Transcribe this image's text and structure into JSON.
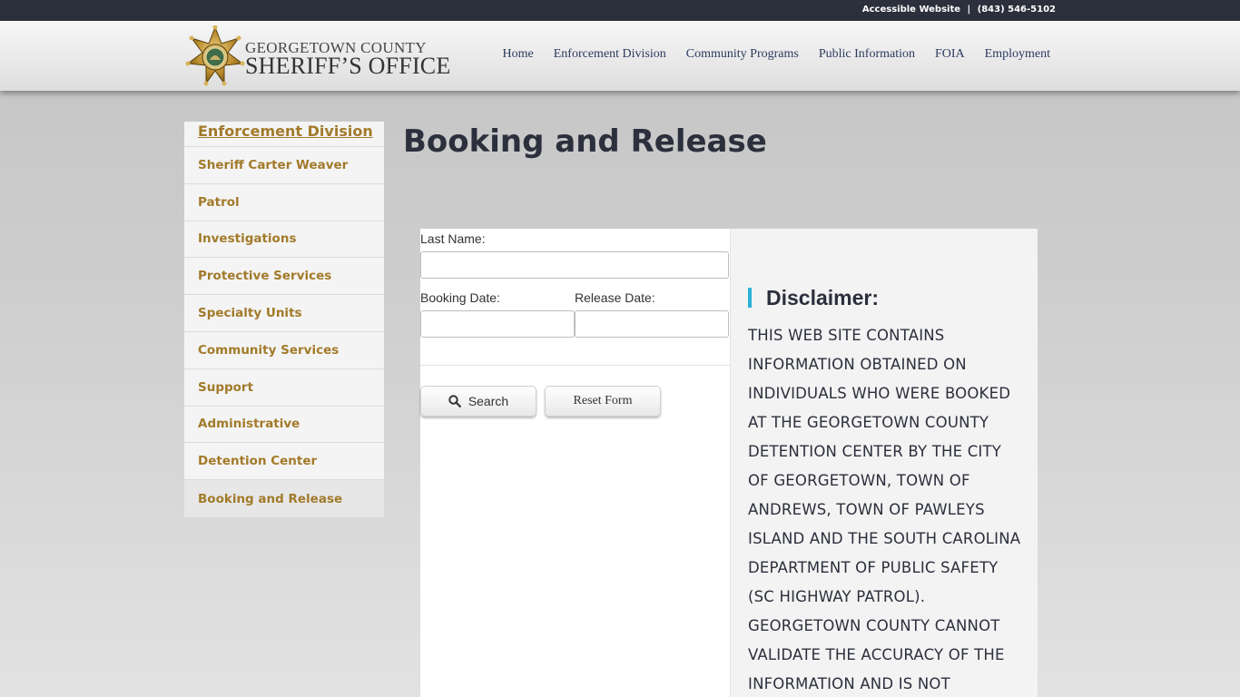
{
  "topbar": {
    "accessible_link": "Accessible Website",
    "separator": "|",
    "phone": "(843) 546-5102"
  },
  "logo": {
    "line1": "GEORGETOWN COUNTY",
    "line2": "SHERIFF’S OFFICE"
  },
  "nav": {
    "items": [
      "Home",
      "Enforcement Division",
      "Community Programs",
      "Public Information",
      "FOIA",
      "Employment"
    ]
  },
  "sidebar": {
    "heading": "Enforcement Division",
    "items": [
      {
        "label": "Sheriff Carter Weaver"
      },
      {
        "label": "Patrol"
      },
      {
        "label": "Investigations"
      },
      {
        "label": "Protective Services"
      },
      {
        "label": "Specialty Units"
      },
      {
        "label": "Community Services"
      },
      {
        "label": "Support"
      },
      {
        "label": "Administrative"
      },
      {
        "label": "Detention Center"
      },
      {
        "label": "Booking and Release",
        "active": true
      }
    ]
  },
  "page": {
    "title": "Booking and Release"
  },
  "form": {
    "last_name_label": "Last Name:",
    "last_name_value": "",
    "booking_date_label": "Booking Date:",
    "booking_date_value": "",
    "release_date_label": "Release Date:",
    "release_date_value": "",
    "search_label": "Search",
    "reset_label": "Reset Form"
  },
  "disclaimer": {
    "title": "Disclaimer:",
    "text": "This web site contains information obtained on individuals who were booked at the Georgetown County Detention Center by the City of Georgetown, Town of Andrews, Town of Pawleys Island and the South Carolina Department of Public Safety (SC Highway Patrol). Georgetown County cannot validate the accuracy of the information and is not responsible for any"
  },
  "colors": {
    "topbar": "#2c2f3c",
    "nav_text": "#2b3a5e",
    "sidebar_text": "#a27a2a",
    "accent_bar": "#2ab1d9",
    "title": "#2c2f3c"
  }
}
